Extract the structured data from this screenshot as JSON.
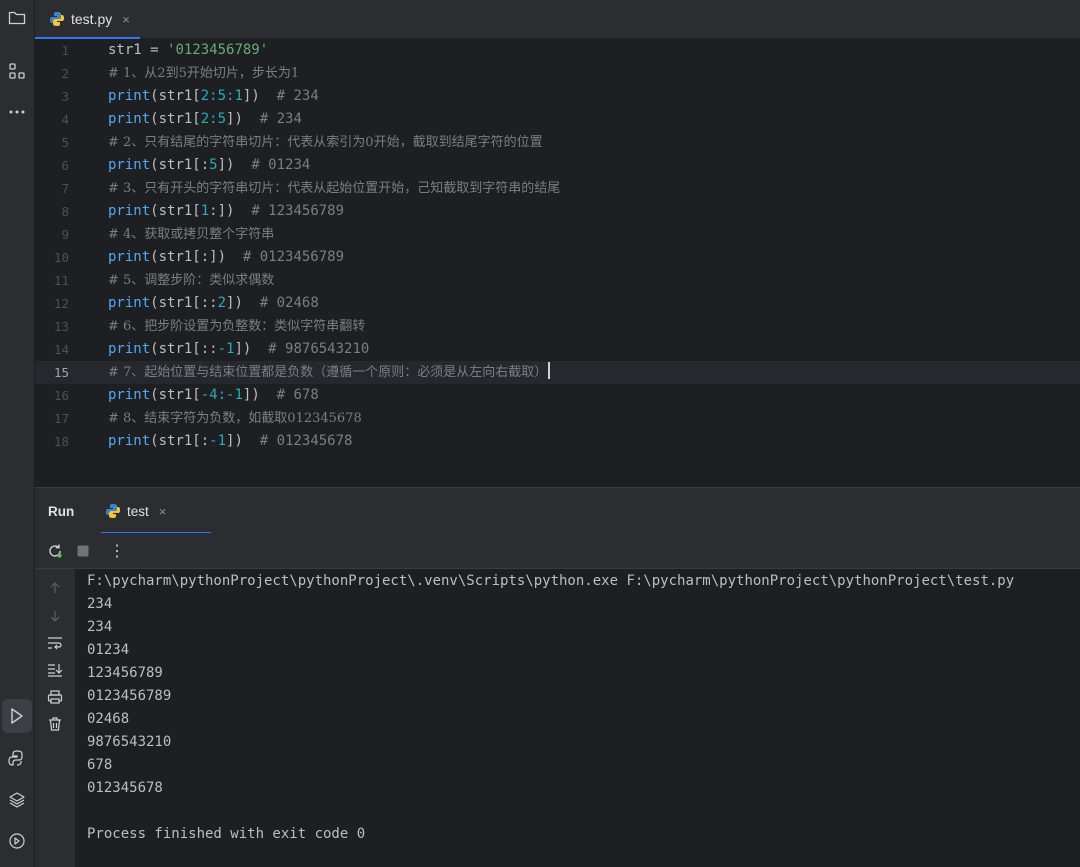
{
  "editor": {
    "tab": {
      "label": "test.py",
      "close": "×"
    },
    "current_line": 15,
    "lines": [
      "1",
      "2",
      "3",
      "4",
      "5",
      "6",
      "7",
      "8",
      "9",
      "10",
      "11",
      "12",
      "13",
      "14",
      "15",
      "16",
      "17",
      "18"
    ],
    "code": {
      "l1": "str1 = ",
      "l1_str": "'0123456789'",
      "l2": "# 1、从2到5开始切片，步长为1",
      "l3_fn": "print",
      "l3_a": "(str1[",
      "l3_n": "2:5:1",
      "l3_b": "])  ",
      "l3_c": "# 234",
      "l4_fn": "print",
      "l4_a": "(str1[",
      "l4_n": "2:5",
      "l4_b": "])  ",
      "l4_c": "# 234",
      "l5": "# 2、只有结尾的字符串切片：代表从索引为0开始，截取到结尾字符的位置",
      "l6_fn": "print",
      "l6_a": "(str1[:",
      "l6_n": "5",
      "l6_b": "])  ",
      "l6_c": "# 01234",
      "l7": "# 3、只有开头的字符串切片：代表从起始位置开始，己知截取到字符串的结尾",
      "l8_fn": "print",
      "l8_a": "(str1[",
      "l8_n": "1",
      "l8_b": ":])  ",
      "l8_c": "# 123456789",
      "l9": "# 4、获取或拷贝整个字符串",
      "l10_fn": "print",
      "l10_a": "(str1[:])  ",
      "l10_c": "# 0123456789",
      "l11": "# 5、调整步阶：类似求偶数",
      "l12_fn": "print",
      "l12_a": "(str1[::",
      "l12_n": "2",
      "l12_b": "])  ",
      "l12_c": "# 02468",
      "l13": "# 6、把步阶设置为负整数：类似字符串翻转",
      "l14_fn": "print",
      "l14_a": "(str1[::",
      "l14_n": "-1",
      "l14_b": "])  ",
      "l14_c": "# 9876543210",
      "l15": "# 7、起始位置与结束位置都是负数（遵循一个原则：必须是从左向右截取）",
      "l16_fn": "print",
      "l16_a": "(str1[",
      "l16_n": "-4:-1",
      "l16_b": "])  ",
      "l16_c": "# 678",
      "l17": "# 8、结束字符为负数，如截取012345678",
      "l18_fn": "print",
      "l18_a": "(str1[:",
      "l18_n": "-1",
      "l18_b": "])  ",
      "l18_c": "# 012345678"
    }
  },
  "run": {
    "title": "Run",
    "tab_label": "test",
    "tab_close": "×",
    "toolbar_more": "⋮",
    "output": [
      "F:\\pycharm\\pythonProject\\pythonProject\\.venv\\Scripts\\python.exe F:\\pycharm\\pythonProject\\pythonProject\\test.py",
      "234",
      "234",
      "01234",
      "123456789",
      "0123456789",
      "02468",
      "9876543210",
      "678",
      "012345678",
      "",
      "Process finished with exit code 0"
    ]
  },
  "colors": {
    "background": "#1e1f22",
    "panel": "#2b2d30",
    "accent": "#3574f0",
    "function": "#56a8f5",
    "string": "#6aab73",
    "number": "#2aacb8",
    "comment": "#7a7e85"
  },
  "icons": {
    "toolstrip": [
      "folder-icon",
      "structure-icon",
      "more-icon",
      "run-icon",
      "python-console-icon",
      "layers-icon",
      "services-icon"
    ],
    "run_toolbar": [
      "rerun-icon",
      "stop-icon",
      "more-vertical-icon"
    ],
    "run_side": [
      "up-arrow-icon",
      "down-arrow-icon",
      "soft-wrap-icon",
      "scroll-to-end-icon",
      "print-icon",
      "trash-icon"
    ]
  }
}
